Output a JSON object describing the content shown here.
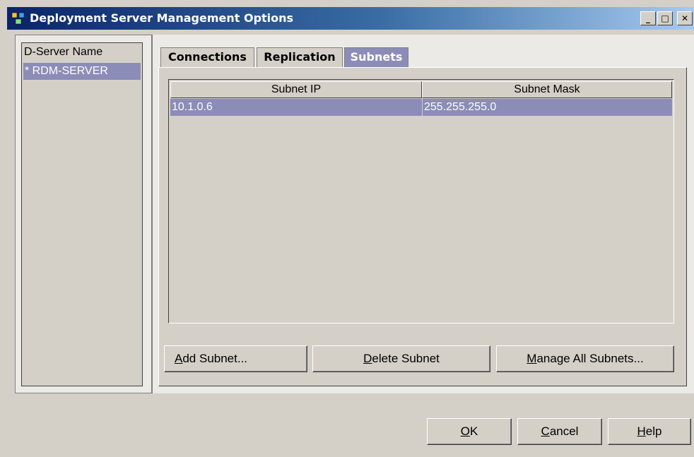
{
  "window": {
    "title": "Deployment Server Management Options",
    "controls": {
      "minimize": "_",
      "maximize": "□",
      "close": "✕"
    }
  },
  "server_list": {
    "header": "D-Server Name",
    "items": [
      {
        "label": "* RDM-SERVER",
        "selected": true
      }
    ]
  },
  "tabs": [
    {
      "label": "Connections",
      "active": false
    },
    {
      "label": "Replication",
      "active": false
    },
    {
      "label": "Subnets",
      "active": true
    }
  ],
  "subnets_table": {
    "columns": [
      "Subnet IP",
      "Subnet Mask"
    ],
    "rows": [
      {
        "ip": "10.1.0.6",
        "mask": "255.255.255.0",
        "selected": true
      }
    ]
  },
  "tab_buttons": {
    "add": {
      "mnemonic": "A",
      "rest": "dd Subnet..."
    },
    "delete": {
      "mnemonic": "D",
      "rest": "elete Subnet"
    },
    "manage": {
      "mnemonic": "M",
      "rest": "anage All Subnets..."
    }
  },
  "dialog_buttons": {
    "ok": {
      "mnemonic": "O",
      "rest": "K"
    },
    "cancel": {
      "mnemonic": "C",
      "rest": "ancel"
    },
    "help": {
      "mnemonic": "H",
      "rest": "elp"
    }
  },
  "colors": {
    "selection": "#8c8cb8",
    "titlebar_start": "#0a246a",
    "face": "#d4d0c8"
  }
}
